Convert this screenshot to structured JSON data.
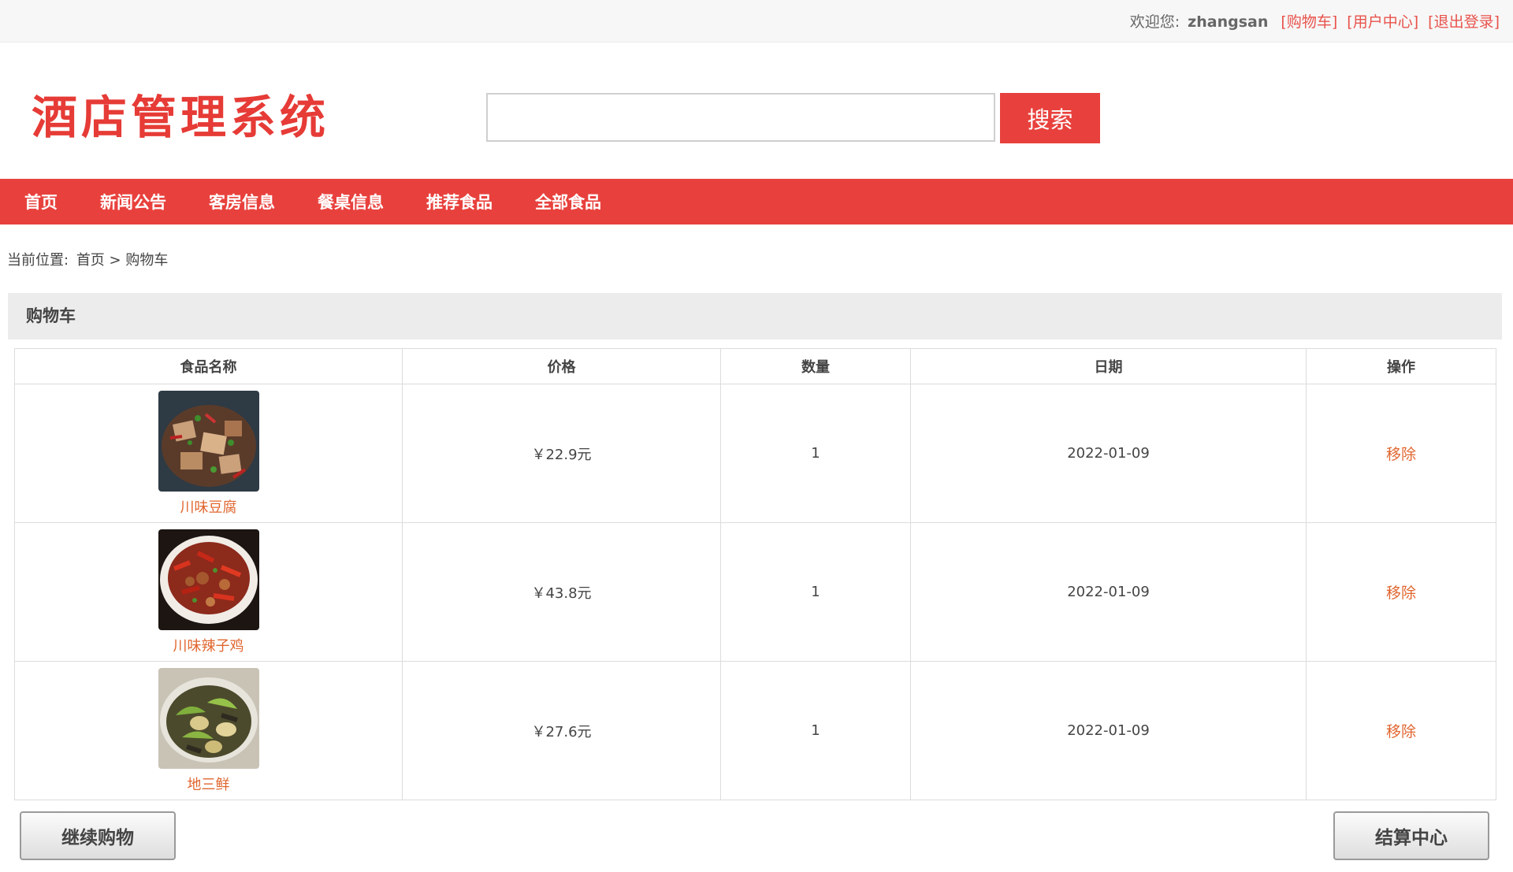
{
  "topbar": {
    "welcome": "欢迎您:",
    "username": "zhangsan",
    "links": [
      "[购物车]",
      "[用户中心]",
      "[退出登录]"
    ]
  },
  "header": {
    "logo": "酒店管理系统",
    "search_placeholder": "",
    "search_button": "搜索"
  },
  "nav": {
    "items": [
      "首页",
      "新闻公告",
      "客房信息",
      "餐桌信息",
      "推荐食品",
      "全部食品"
    ]
  },
  "breadcrumb": {
    "prefix": "当前位置:",
    "home": "首页 >",
    "current": "购物车"
  },
  "panel": {
    "title": "购物车"
  },
  "table": {
    "headers": [
      "食品名称",
      "价格",
      "数量",
      "日期",
      "操作"
    ],
    "rows": [
      {
        "name": "川味豆腐",
        "price": "￥22.9元",
        "qty": "1",
        "date": "2022-01-09",
        "action": "移除",
        "image_icon": "tofu-dish-photo"
      },
      {
        "name": "川味辣子鸡",
        "price": "￥43.8元",
        "qty": "1",
        "date": "2022-01-09",
        "action": "移除",
        "image_icon": "spicy-chicken-photo"
      },
      {
        "name": "地三鲜",
        "price": "￥27.6元",
        "qty": "1",
        "date": "2022-01-09",
        "action": "移除",
        "image_icon": "disanxian-photo"
      }
    ]
  },
  "buttons": {
    "continue": "继续购物",
    "checkout": "结算中心"
  },
  "colors": {
    "brand_red": "#e8413d",
    "link_orange": "#e0662f"
  }
}
